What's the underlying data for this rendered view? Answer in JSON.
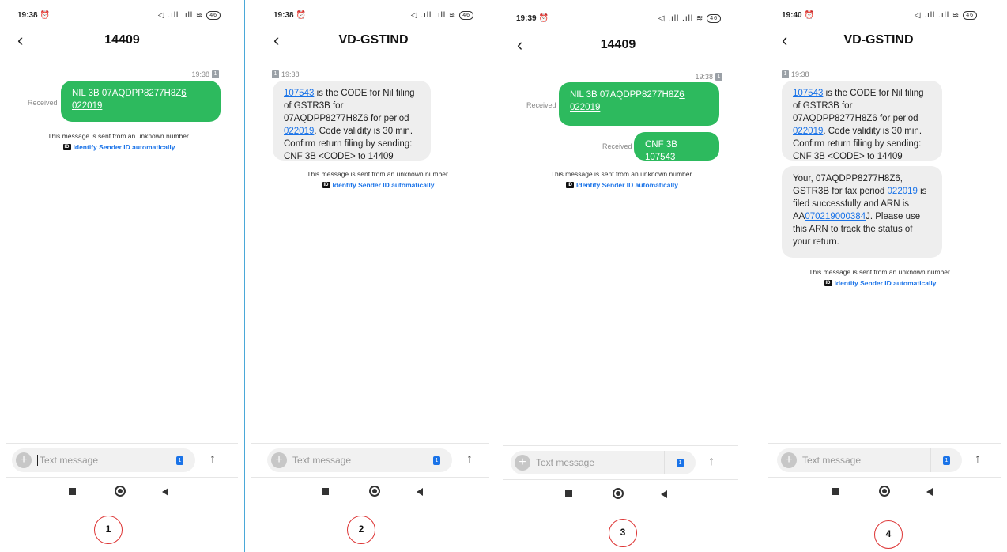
{
  "panels": [
    {
      "status_time": "19:38",
      "title": "14409",
      "msg_time": "19:38",
      "received_label": "Received",
      "sent_1_a": "NIL 3B 07AQDPP8277H8Z",
      "sent_1_b": "6",
      "sent_1_c": "022019",
      "notice": "This message is sent from an unknown number.",
      "identify": "Identify Sender ID automatically",
      "placeholder": "Text message",
      "label": "1"
    },
    {
      "status_time": "19:38",
      "title": "VD-GSTIND",
      "msg_time": "19:38",
      "code": "107543",
      "msg_a": " is the CODE for Nil filing of GSTR3B for 07AQDPP8277H8Z6 for period ",
      "period": "022019",
      "msg_b": ". Code validity is 30 min. Confirm return filing by sending: CNF 3B <CODE> to 14409",
      "notice": "This message is sent from an unknown number.",
      "identify": "Identify Sender ID automatically",
      "placeholder": "Text message",
      "label": "2"
    },
    {
      "status_time": "19:39",
      "title": "14409",
      "msg_time": "19:38",
      "received_label": "Received",
      "sent_1_a": "NIL 3B 07AQDPP8277H8Z",
      "sent_1_b": "6",
      "sent_1_c": "022019",
      "received_label_2": "Received",
      "sent_2_a": "CNF 3B ",
      "sent_2_b": "107543",
      "notice": "This message is sent from an unknown number.",
      "identify": "Identify Sender ID automatically",
      "placeholder": "Text message",
      "label": "3"
    },
    {
      "status_time": "19:40",
      "title": "VD-GSTIND",
      "msg_time": "19:38",
      "code": "107543",
      "msg_a": " is the CODE for Nil filing of GSTR3B for 07AQDPP8277H8Z6 for period ",
      "period": "022019",
      "msg_b": ". Code validity is 30 min. Confirm return filing by sending: CNF 3B <CODE> to 14409",
      "msg2_a": "Your, 07AQDPP8277H8Z6, GSTR3B for tax period ",
      "msg2_period": "022019",
      "msg2_b": " is filed successfully and ARN is AA",
      "arn": "070219000384",
      "msg2_c": "J. Please use this ARN to track the status of your return.",
      "notice": "This message is sent from an unknown number.",
      "identify": "Identify Sender ID automatically",
      "placeholder": "Text message",
      "label": "4"
    }
  ],
  "status_icons": "◁ .ıll .ıll ≋",
  "battery": "46",
  "sim_badge": "1",
  "id_badge": "ID",
  "icons": {
    "back": "back-arrow-icon",
    "plus": "plus-icon",
    "send": "send-arrow-icon",
    "nav_recent": "square-icon",
    "nav_home": "circle-icon",
    "nav_back": "triangle-icon"
  },
  "colors": {
    "bubble_out": "#2dba5e",
    "bubble_in": "#eeeeee",
    "link": "#1a73e8",
    "circle": "#dd3333",
    "divider": "#4aa8d8"
  }
}
